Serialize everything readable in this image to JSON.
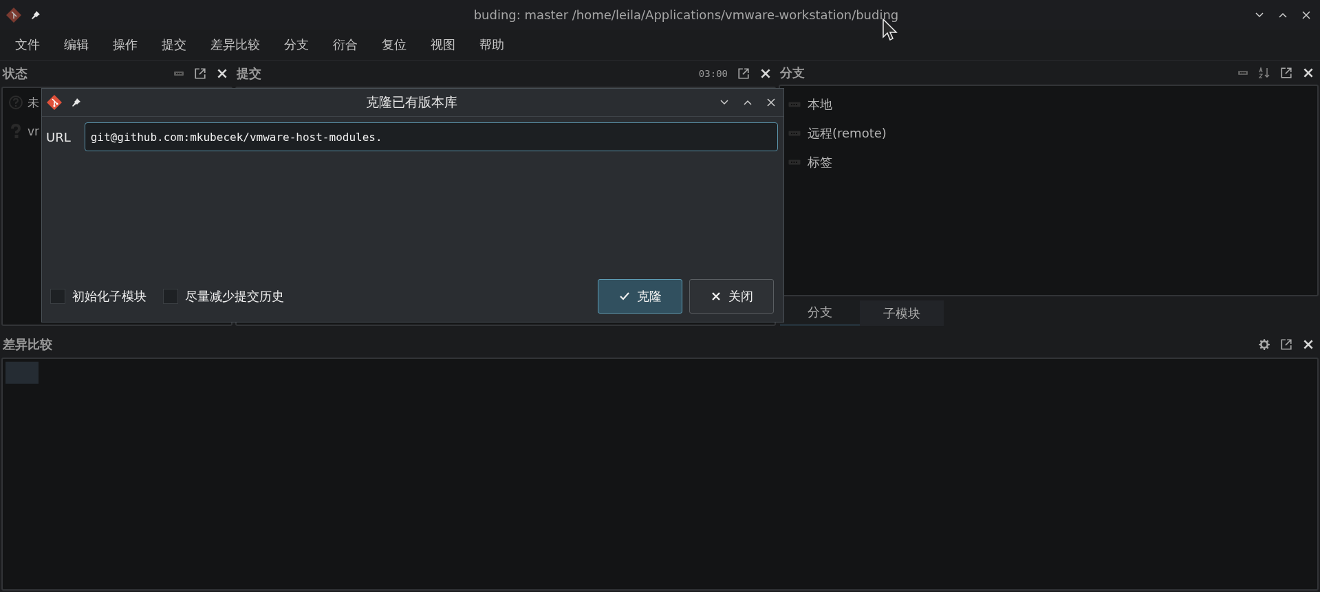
{
  "window": {
    "title": "buding: master /home/leila/Applications/vmware-workstation/buding"
  },
  "menu": [
    "文件",
    "编辑",
    "操作",
    "提交",
    "差异比较",
    "分支",
    "衍合",
    "复位",
    "视图",
    "帮助"
  ],
  "status_panel": {
    "title": "状态",
    "items": [
      {
        "kind": "unknown",
        "label": "未"
      },
      {
        "kind": "untracked",
        "label": "vr"
      }
    ]
  },
  "commit_panel": {
    "title": "提交",
    "time": "03:00"
  },
  "branch_panel": {
    "title": "分支",
    "items": [
      {
        "label": "本地"
      },
      {
        "label": "远程(remote)"
      },
      {
        "label": "标签"
      }
    ],
    "tabs": [
      {
        "label": "分支",
        "selected": true
      },
      {
        "label": "子模块",
        "selected": false
      }
    ]
  },
  "diff_panel": {
    "title": "差异比较"
  },
  "dialog": {
    "title": "克隆已有版本库",
    "url_label": "URL",
    "url_value": "git@github.com:mkubecek/vmware-host-modules.",
    "options": [
      {
        "label": "初始化子模块",
        "checked": false
      },
      {
        "label": "尽量减少提交历史",
        "checked": false
      }
    ],
    "buttons": [
      {
        "label": "克隆",
        "kind": "accept"
      },
      {
        "label": "关闭",
        "kind": "close"
      }
    ]
  }
}
